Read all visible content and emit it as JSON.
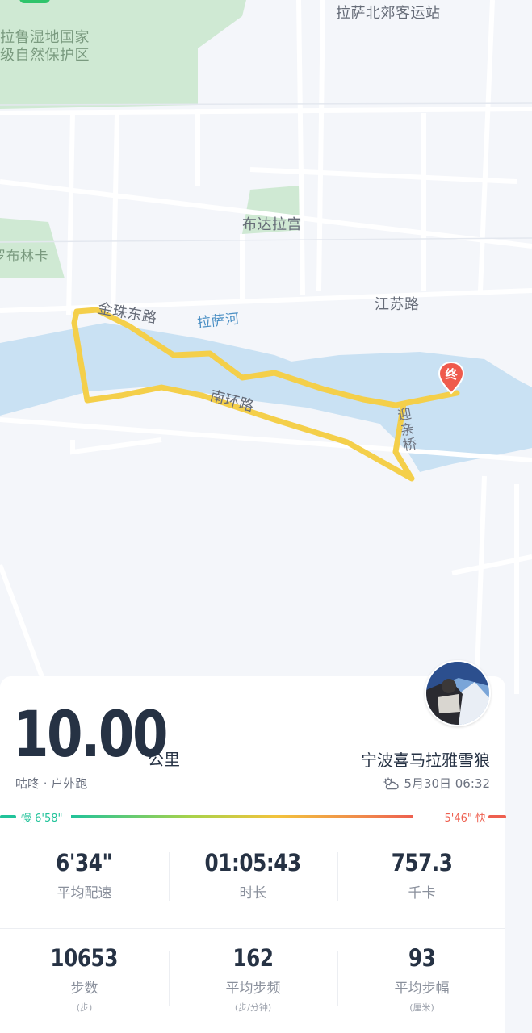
{
  "map": {
    "labels": {
      "wetland": "拉鲁湿地国家\n级自然保护区",
      "bus_station": "拉萨北郊客运站",
      "palace": "布达拉宫",
      "lingka": "罗布林卡",
      "road_jinzhu": "金珠东路",
      "river": "拉萨河",
      "road_jiangsu": "江苏路",
      "road_nanhuan": "南环路",
      "bridge": "迎\n亲\n桥"
    },
    "end_marker": "终",
    "colors": {
      "route": "#f4cf4a",
      "water": "#c9e1f3",
      "park": "#cfe9d3"
    }
  },
  "avatar": {
    "icon": "avatar-photo"
  },
  "summary": {
    "distance": "10.00",
    "unit": "公里",
    "source": "咕咚 · 户外跑",
    "username": "宁波喜马拉雅雪狼",
    "weather_icon": "partly-cloudy-icon",
    "datetime": "5月30日 06:32"
  },
  "pace": {
    "slow": "慢 6'58\"",
    "fast": "5'46\" 快"
  },
  "stats": [
    {
      "value": "6'34\"",
      "label": "平均配速",
      "sub": ""
    },
    {
      "value": "01:05:43",
      "label": "时长",
      "sub": ""
    },
    {
      "value": "757.3",
      "label": "千卡",
      "sub": ""
    },
    {
      "value": "10653",
      "label": "步数",
      "sub": "(步)"
    },
    {
      "value": "162",
      "label": "平均步频",
      "sub": "(步/分钟)"
    },
    {
      "value": "93",
      "label": "平均步幅",
      "sub": "(厘米)"
    }
  ]
}
